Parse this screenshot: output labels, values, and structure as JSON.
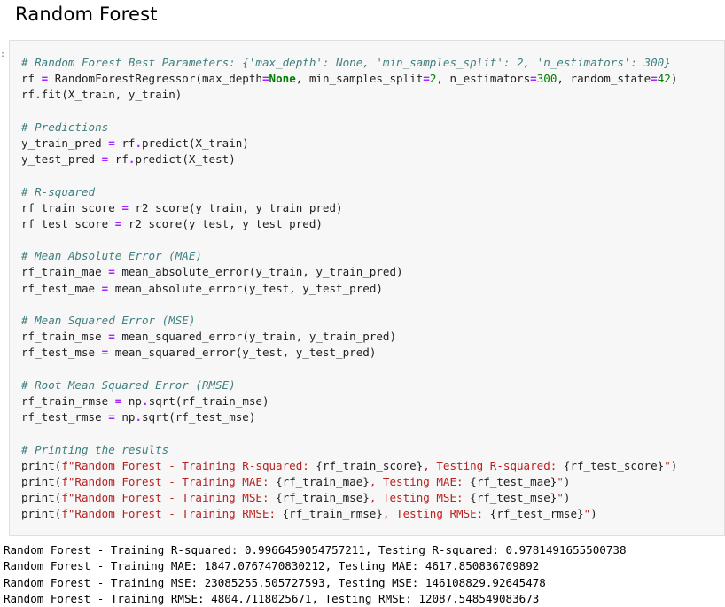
{
  "heading": "Random Forest",
  "cell_prompt": ":",
  "code_lines": [
    [
      {
        "c": "cm",
        "t": "# Random Forest Best Parameters: {'max_depth': None, 'min_samples_split': 2, 'n_estimators': 300}"
      }
    ],
    [
      {
        "c": "",
        "t": "rf "
      },
      {
        "c": "op",
        "t": "="
      },
      {
        "c": "",
        "t": " RandomForestRegressor(max_depth"
      },
      {
        "c": "op",
        "t": "="
      },
      {
        "c": "kw",
        "t": "None"
      },
      {
        "c": "",
        "t": ", min_samples_split"
      },
      {
        "c": "op",
        "t": "="
      },
      {
        "c": "nu",
        "t": "2"
      },
      {
        "c": "",
        "t": ", n_estimators"
      },
      {
        "c": "op",
        "t": "="
      },
      {
        "c": "nu",
        "t": "300"
      },
      {
        "c": "",
        "t": ", random_state"
      },
      {
        "c": "op",
        "t": "="
      },
      {
        "c": "nu",
        "t": "42"
      },
      {
        "c": "",
        "t": ")"
      }
    ],
    [
      {
        "c": "",
        "t": "rf"
      },
      {
        "c": "op",
        "t": "."
      },
      {
        "c": "",
        "t": "fit(X_train, y_train)"
      }
    ],
    [],
    [
      {
        "c": "cm",
        "t": "# Predictions"
      }
    ],
    [
      {
        "c": "",
        "t": "y_train_pred "
      },
      {
        "c": "op",
        "t": "="
      },
      {
        "c": "",
        "t": " rf"
      },
      {
        "c": "op",
        "t": "."
      },
      {
        "c": "",
        "t": "predict(X_train)"
      }
    ],
    [
      {
        "c": "",
        "t": "y_test_pred "
      },
      {
        "c": "op",
        "t": "="
      },
      {
        "c": "",
        "t": " rf"
      },
      {
        "c": "op",
        "t": "."
      },
      {
        "c": "",
        "t": "predict(X_test)"
      }
    ],
    [],
    [
      {
        "c": "cm",
        "t": "# R-squared"
      }
    ],
    [
      {
        "c": "",
        "t": "rf_train_score "
      },
      {
        "c": "op",
        "t": "="
      },
      {
        "c": "",
        "t": " r2_score(y_train, y_train_pred)"
      }
    ],
    [
      {
        "c": "",
        "t": "rf_test_score "
      },
      {
        "c": "op",
        "t": "="
      },
      {
        "c": "",
        "t": " r2_score(y_test, y_test_pred)"
      }
    ],
    [],
    [
      {
        "c": "cm",
        "t": "# Mean Absolute Error (MAE)"
      }
    ],
    [
      {
        "c": "",
        "t": "rf_train_mae "
      },
      {
        "c": "op",
        "t": "="
      },
      {
        "c": "",
        "t": " mean_absolute_error(y_train, y_train_pred)"
      }
    ],
    [
      {
        "c": "",
        "t": "rf_test_mae "
      },
      {
        "c": "op",
        "t": "="
      },
      {
        "c": "",
        "t": " mean_absolute_error(y_test, y_test_pred)"
      }
    ],
    [],
    [
      {
        "c": "cm",
        "t": "# Mean Squared Error (MSE)"
      }
    ],
    [
      {
        "c": "",
        "t": "rf_train_mse "
      },
      {
        "c": "op",
        "t": "="
      },
      {
        "c": "",
        "t": " mean_squared_error(y_train, y_train_pred)"
      }
    ],
    [
      {
        "c": "",
        "t": "rf_test_mse "
      },
      {
        "c": "op",
        "t": "="
      },
      {
        "c": "",
        "t": " mean_squared_error(y_test, y_test_pred)"
      }
    ],
    [],
    [
      {
        "c": "cm",
        "t": "# Root Mean Squared Error (RMSE)"
      }
    ],
    [
      {
        "c": "",
        "t": "rf_train_rmse "
      },
      {
        "c": "op",
        "t": "="
      },
      {
        "c": "",
        "t": " np"
      },
      {
        "c": "op",
        "t": "."
      },
      {
        "c": "",
        "t": "sqrt(rf_train_mse)"
      }
    ],
    [
      {
        "c": "",
        "t": "rf_test_rmse "
      },
      {
        "c": "op",
        "t": "="
      },
      {
        "c": "",
        "t": " np"
      },
      {
        "c": "op",
        "t": "."
      },
      {
        "c": "",
        "t": "sqrt(rf_test_mse)"
      }
    ],
    [],
    [
      {
        "c": "cm",
        "t": "# Printing the results"
      }
    ],
    [
      {
        "c": "",
        "t": "print("
      },
      {
        "c": "st",
        "t": "f\"Random Forest - Training R-squared: "
      },
      {
        "c": "",
        "t": "{rf_train_score}"
      },
      {
        "c": "st",
        "t": ", Testing R-squared: "
      },
      {
        "c": "",
        "t": "{rf_test_score}"
      },
      {
        "c": "st",
        "t": "\""
      },
      {
        "c": "",
        "t": ")"
      }
    ],
    [
      {
        "c": "",
        "t": "print("
      },
      {
        "c": "st",
        "t": "f\"Random Forest - Training MAE: "
      },
      {
        "c": "",
        "t": "{rf_train_mae}"
      },
      {
        "c": "st",
        "t": ", Testing MAE: "
      },
      {
        "c": "",
        "t": "{rf_test_mae}"
      },
      {
        "c": "st",
        "t": "\""
      },
      {
        "c": "",
        "t": ")"
      }
    ],
    [
      {
        "c": "",
        "t": "print("
      },
      {
        "c": "st",
        "t": "f\"Random Forest - Training MSE: "
      },
      {
        "c": "",
        "t": "{rf_train_mse}"
      },
      {
        "c": "st",
        "t": ", Testing MSE: "
      },
      {
        "c": "",
        "t": "{rf_test_mse}"
      },
      {
        "c": "st",
        "t": "\""
      },
      {
        "c": "",
        "t": ")"
      }
    ],
    [
      {
        "c": "",
        "t": "print("
      },
      {
        "c": "st",
        "t": "f\"Random Forest - Training RMSE: "
      },
      {
        "c": "",
        "t": "{rf_train_rmse}"
      },
      {
        "c": "st",
        "t": ", Testing RMSE: "
      },
      {
        "c": "",
        "t": "{rf_test_rmse}"
      },
      {
        "c": "st",
        "t": "\""
      },
      {
        "c": "",
        "t": ")"
      }
    ]
  ],
  "output_lines": [
    "Random Forest - Training R-squared: 0.9966459054757211, Testing R-squared: 0.9781491655500738",
    "Random Forest - Training MAE: 1847.0767470830212, Testing MAE: 4617.850836709892",
    "Random Forest - Training MSE: 23085255.505727593, Testing MSE: 146108829.92645478",
    "Random Forest - Training RMSE: 4804.7118025671, Testing RMSE: 12087.548549083673"
  ],
  "colors": {
    "comment": "#408080",
    "keyword": "#008000",
    "number": "#008000",
    "string": "#ba2121",
    "operator": "#aa22ff",
    "cell_background": "#f7f7f7"
  }
}
